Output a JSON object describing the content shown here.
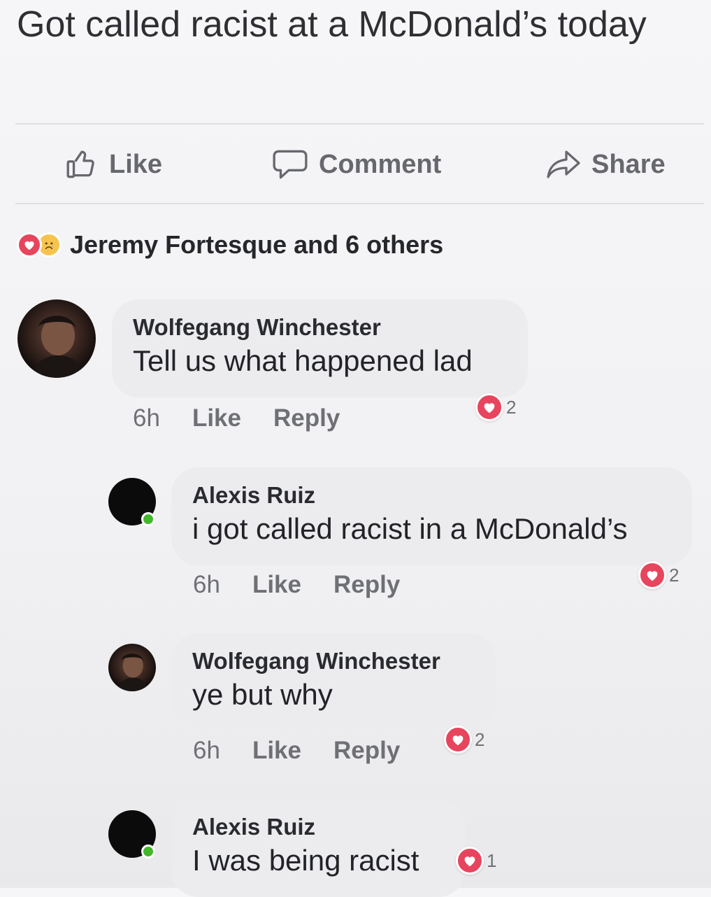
{
  "post": {
    "text": "Got called r⁢acist at a McDonald’s today"
  },
  "actions": {
    "like_label": "Like",
    "comment_label": "Comment",
    "share_label": "Share"
  },
  "reactions": {
    "summary": "Jeremy Fortesque and 6 others",
    "icons": [
      "heart-icon",
      "sad-face-icon"
    ]
  },
  "comments": [
    {
      "author": "Wolfegang Winchester",
      "text": "Tell us what happened lad",
      "time": "6h",
      "like_label": "Like",
      "reply_label": "Reply",
      "reaction_count": "2"
    },
    {
      "author": "Alexis Ruiz",
      "text": "i got called r⁢acist in a McDonald’s",
      "time": "6h",
      "like_label": "Like",
      "reply_label": "Reply",
      "reaction_count": "2"
    },
    {
      "author": "Wolfegang Winchester",
      "text": "ye but why",
      "time": "6h",
      "like_label": "Like",
      "reply_label": "Reply",
      "reaction_count": "2"
    },
    {
      "author": "Alexis Ruiz",
      "text": "I was being r⁢acist",
      "reaction_count": "1"
    }
  ],
  "colors": {
    "heart": "#e7455e",
    "online": "#42b72a",
    "bubble": "#ececef"
  }
}
